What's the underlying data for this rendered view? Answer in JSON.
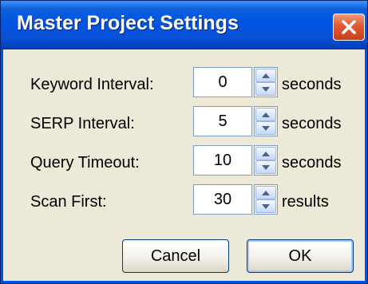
{
  "window": {
    "title": "Master Project Settings",
    "close_icon": "close-icon"
  },
  "settings": [
    {
      "label": "Keyword Interval:",
      "value": "0",
      "unit": "seconds"
    },
    {
      "label": "SERP Interval:",
      "value": "5",
      "unit": "seconds"
    },
    {
      "label": "Query Timeout:",
      "value": "10",
      "unit": "seconds"
    },
    {
      "label": "Scan First:",
      "value": "30",
      "unit": "results"
    }
  ],
  "buttons": {
    "cancel_label": "Cancel",
    "ok_label": "OK"
  },
  "colors": {
    "titlebar": "#0054e3",
    "dialog_bg": "#ece9d8",
    "close_button": "#e05a32"
  }
}
